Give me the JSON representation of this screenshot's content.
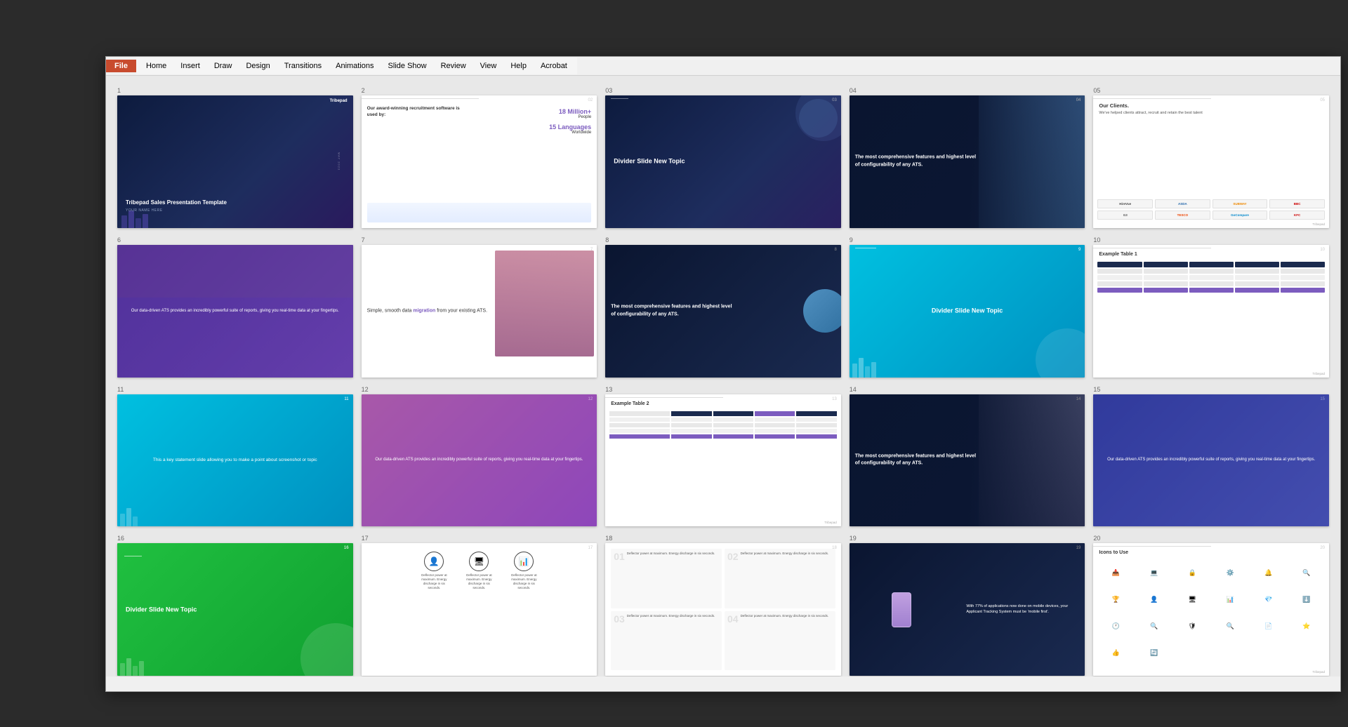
{
  "app": {
    "title": "Tribepad Sales Presentation Template",
    "menu": {
      "file": "File",
      "items": [
        "Home",
        "Insert",
        "Draw",
        "Design",
        "Transitions",
        "Animations",
        "Slide Show",
        "Review",
        "View",
        "Help",
        "Acrobat"
      ]
    }
  },
  "slides": [
    {
      "number": "1",
      "type": "title",
      "title": "Tribepad Sales Presentation Template",
      "subtitle": "YOUR NAME HERE",
      "logo": "Tribepad"
    },
    {
      "number": "2",
      "type": "stats",
      "headline": "Our award-winning recruitment software is used by:",
      "stat1": "18 Million+ People",
      "stat2": "15 Languages Worldwide"
    },
    {
      "number": "03",
      "type": "divider",
      "text": "Divider Slide New Topic"
    },
    {
      "number": "04",
      "type": "features",
      "text": "The most comprehensive features and highest level of configurability of any ATS."
    },
    {
      "number": "05",
      "type": "clients",
      "title": "Our Clients.",
      "subtitle": "We've helped clients attract, recruit and retain the best talent",
      "logos": [
        "HireVue",
        "ASDA",
        "Subway",
        "BBC",
        "G3",
        "TESCO",
        "GoCompare",
        "KFC"
      ]
    },
    {
      "number": "6",
      "type": "photo-text",
      "text": "Our data-driven ATS provides an incredibly powerful suite of reports, giving you real-time data at your fingertips."
    },
    {
      "number": "7",
      "type": "migration",
      "text1": "Simple, smooth data",
      "text2": "migration",
      "text3": "from your existing ATS."
    },
    {
      "number": "8",
      "type": "features-dark",
      "text": "The most comprehensive features and highest level of configurability of any ATS."
    },
    {
      "number": "9",
      "type": "divider-cyan",
      "text": "Divider Slide New Topic"
    },
    {
      "number": "10",
      "type": "table",
      "title": "Example Table 1"
    },
    {
      "number": "11",
      "type": "statement-cyan",
      "text": "This a key statement slide allowing you to make a point about screenshot or topic"
    },
    {
      "number": "12",
      "type": "photo-purple",
      "text": "Our data-driven ATS provides an incredibly powerful suite of reports, giving you real-time data at your fingertips."
    },
    {
      "number": "13",
      "type": "table2",
      "title": "Example Table 2"
    },
    {
      "number": "14",
      "type": "features-photo",
      "text": "The most comprehensive features and highest level of configurability of any ATS."
    },
    {
      "number": "15",
      "type": "photo-purple2",
      "text": "Our data-driven ATS provides an incredibly powerful suite of reports, giving you real-time data at your fingertips."
    },
    {
      "number": "16",
      "type": "divider-green",
      "text": "Divider Slide New Topic"
    },
    {
      "number": "17",
      "type": "icons",
      "icons": [
        "person",
        "monitor",
        "chart"
      ],
      "text": "Deflector power at maximum. Energy discharge in six seconds."
    },
    {
      "number": "18",
      "type": "numbered",
      "items": [
        {
          "num": "01",
          "text": "Deflector power at maximum. Energy discharge in six seconds."
        },
        {
          "num": "02",
          "text": "Deflector power at maximum. Energy discharge in six seconds."
        },
        {
          "num": "03",
          "text": "Deflector power at maximum. Energy discharge in six seconds."
        },
        {
          "num": "04",
          "text": "Deflector power at maximum. Energy discharge in six seconds."
        }
      ]
    },
    {
      "number": "19",
      "type": "mobile",
      "text": "With 77% of applications now done on mobile devices, your Applicant Tracking System must be 'mobile first'."
    },
    {
      "number": "20",
      "type": "icons-list",
      "title": "Icons to Use"
    }
  ]
}
